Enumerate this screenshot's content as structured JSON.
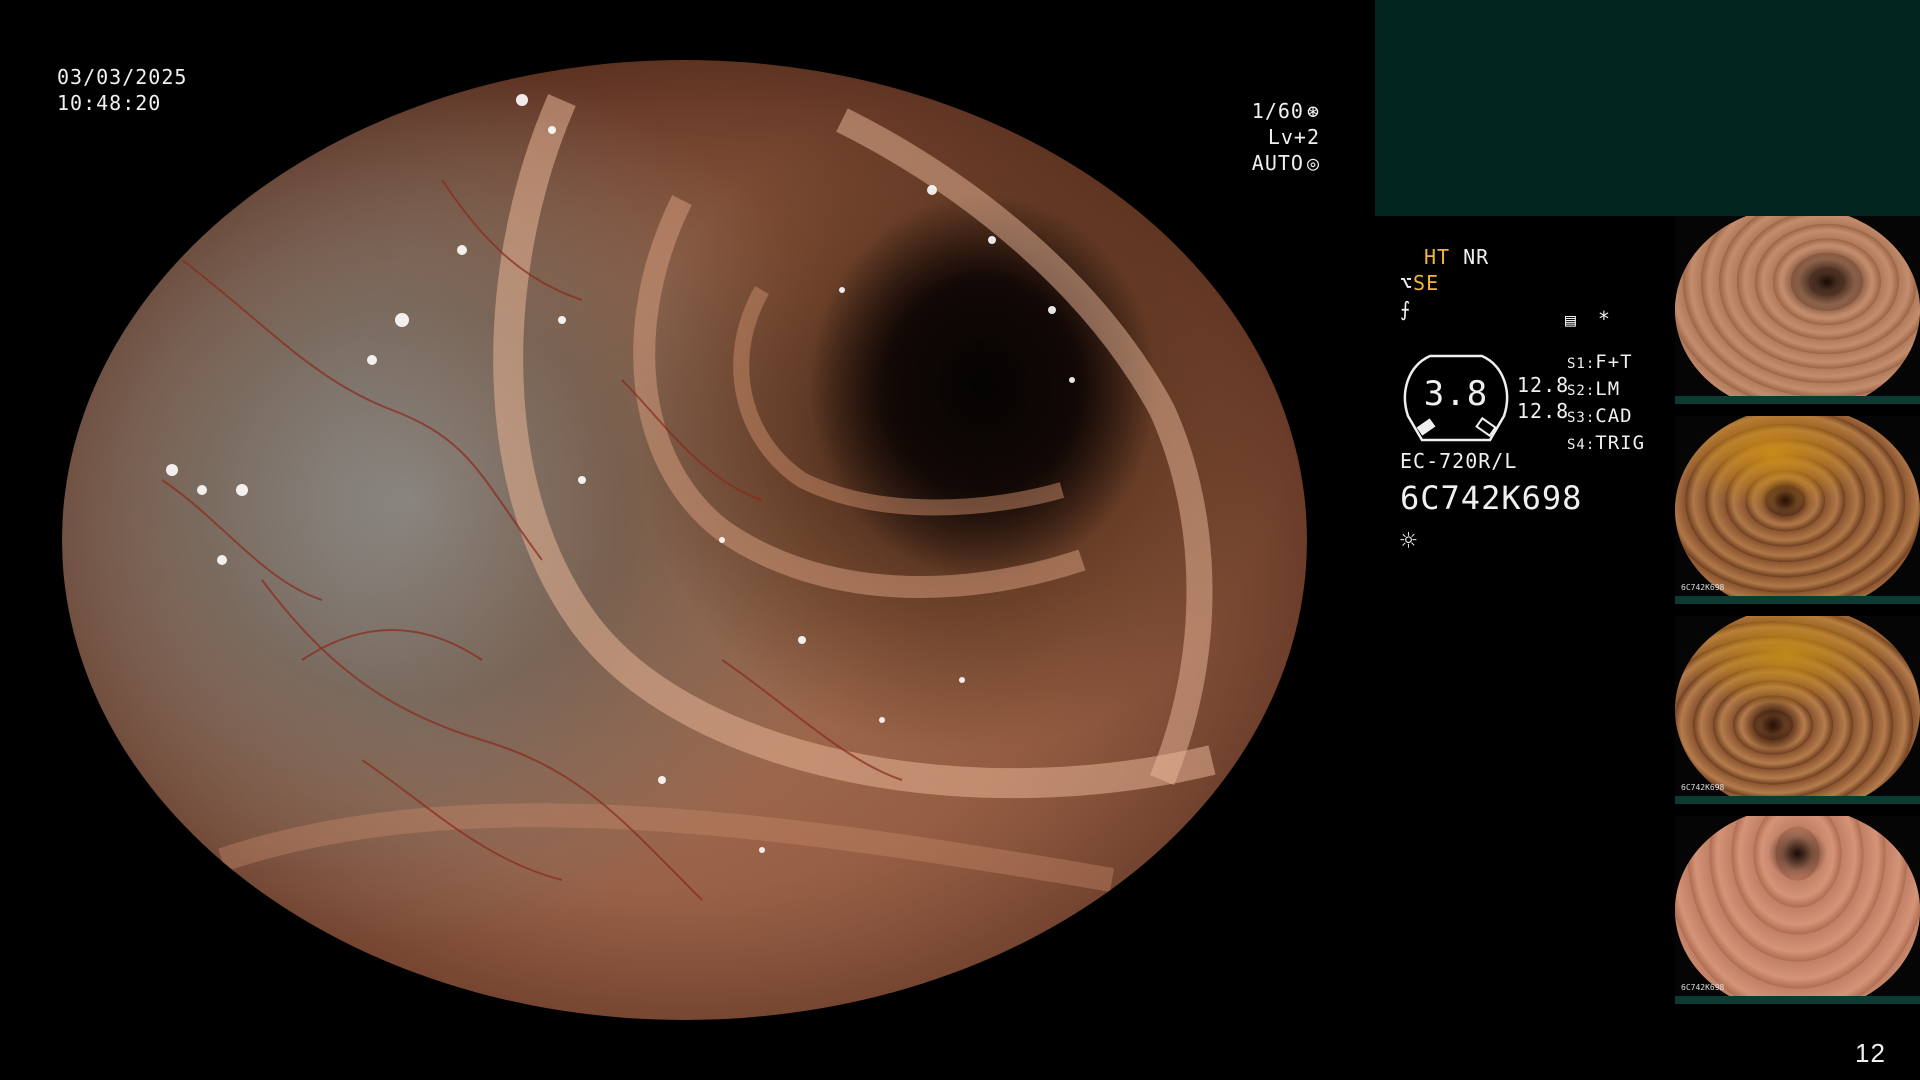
{
  "datetime": {
    "date": "03/03/2025",
    "time": "10:48:20"
  },
  "exposure": {
    "shutter": "1/60",
    "level": "Lv+2",
    "mode": "AUTO"
  },
  "modes": {
    "ht": "HT",
    "nr": "NR",
    "se": "SE",
    "asterisk": "*"
  },
  "gauge": {
    "value": "3.8",
    "top_value": "12.8",
    "bottom_value": "12.8"
  },
  "settings": [
    {
      "key": "S1:",
      "value": "F+T"
    },
    {
      "key": "S2:",
      "value": "LM"
    },
    {
      "key": "S3:",
      "value": "CAD"
    },
    {
      "key": "S4:",
      "value": "TRIG"
    }
  ],
  "scope": {
    "model": "EC-720R/L",
    "serial": "6C742K698"
  },
  "thumbnails": [
    {
      "caption": ""
    },
    {
      "caption": "6C742K698"
    },
    {
      "caption": "6C742K698"
    },
    {
      "caption": "6C742K698"
    }
  ],
  "page_number": "12",
  "colors": {
    "panel": "#01251f",
    "accent": "#f2b43a",
    "text": "#f0f0f0"
  }
}
